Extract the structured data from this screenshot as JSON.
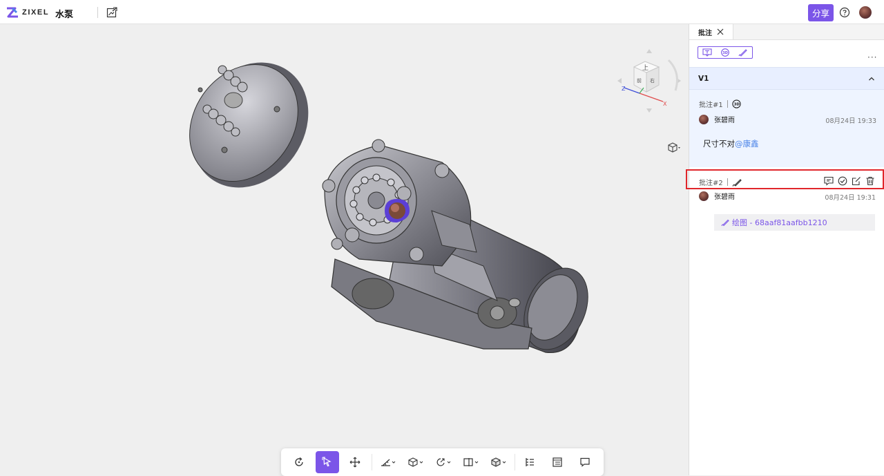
{
  "app": {
    "logo_text": "ZIXEL",
    "doc_title": "水泵",
    "share_label": "分享"
  },
  "colors": {
    "accent": "#7b55e8",
    "mention": "#4d85e8",
    "version_bg": "#e8efff",
    "highlight": "#e0262b"
  },
  "icons": {
    "edit": "edit-image-icon",
    "help": "help-circle-icon",
    "avatar": "user-avatar"
  },
  "viewcube": {
    "faces": [
      "上",
      "前",
      "右"
    ],
    "axes": [
      "Z",
      "X"
    ]
  },
  "toolbar": {
    "items": [
      {
        "name": "rotate",
        "icon": "rotate-icon",
        "active": false
      },
      {
        "name": "select",
        "icon": "cursor-select-icon",
        "active": true
      },
      {
        "name": "pan",
        "icon": "move-arrows-icon",
        "active": false
      },
      {
        "name": "measure",
        "icon": "ruler-icon",
        "dropdown": true
      },
      {
        "name": "section",
        "icon": "section-cube-icon",
        "dropdown": true
      },
      {
        "name": "explode",
        "icon": "explode-icon",
        "dropdown": true
      },
      {
        "name": "split-view",
        "icon": "split-view-icon",
        "dropdown": true
      },
      {
        "name": "display-mode",
        "icon": "display-cube-icon",
        "dropdown": true
      },
      {
        "name": "structure-tree",
        "icon": "tree-list-icon"
      },
      {
        "name": "properties",
        "icon": "properties-list-icon"
      },
      {
        "name": "comments",
        "icon": "comment-icon"
      }
    ]
  },
  "panel": {
    "tab_label": "批注",
    "filters": [
      "text-annotation-icon",
      "3d-annotation-icon",
      "pen-annotation-icon"
    ],
    "more": "···",
    "version": "V1",
    "comments": [
      {
        "id": "批注#1",
        "type_icon": "3d-annotation-icon",
        "user": "张碧雨",
        "time": "08月24日 19:33",
        "text": "尺寸不对",
        "mention": "@康鑫"
      },
      {
        "id": "批注#2",
        "type_icon": "pen-annotation-icon",
        "user": "张碧雨",
        "time": "08月24日 19:31",
        "attachment": "绘图 - 68aaf81aafbb1210",
        "actions": [
          "reply-icon",
          "resolve-icon",
          "edit-icon",
          "delete-icon"
        ]
      }
    ]
  }
}
